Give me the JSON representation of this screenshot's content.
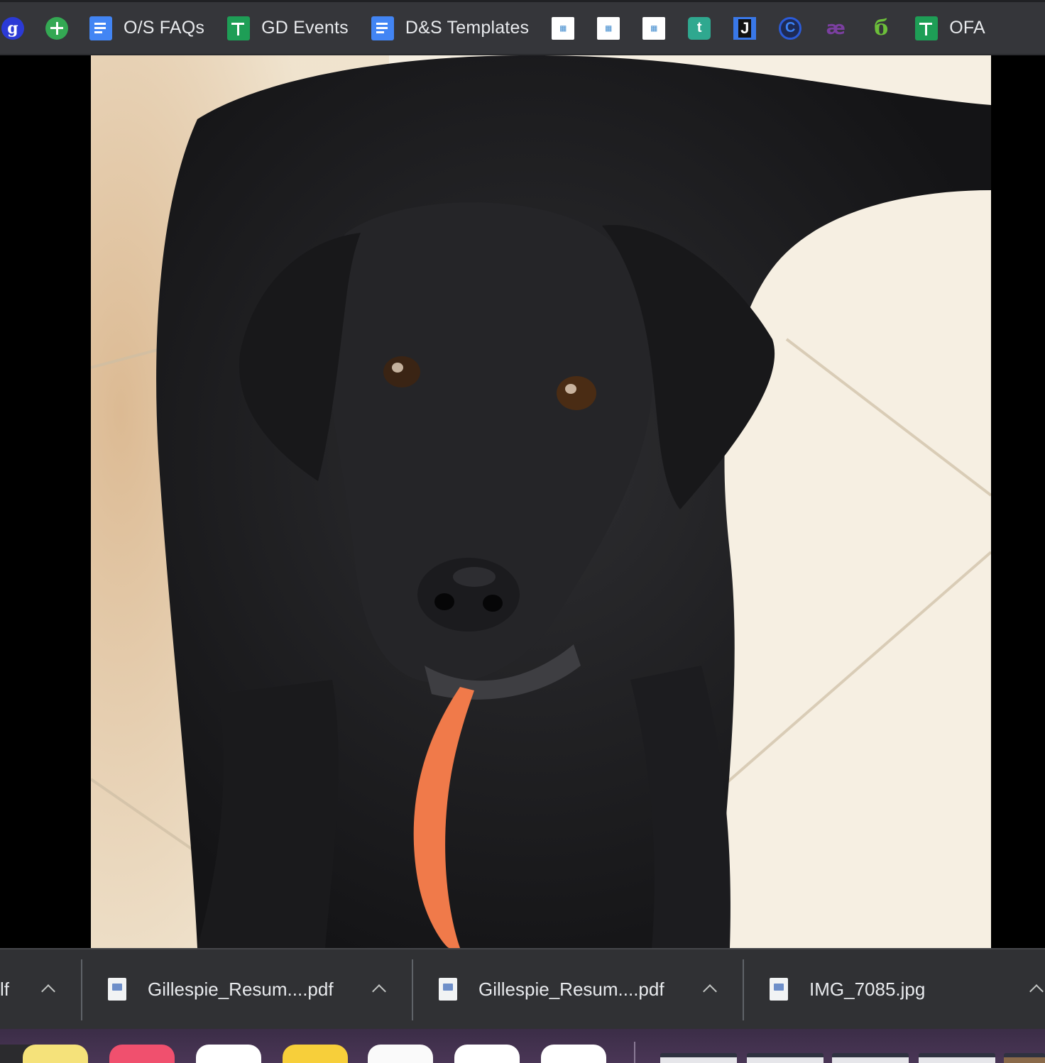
{
  "bookmarks": {
    "items": [
      {
        "icon": "goodreads-g-icon",
        "label": "",
        "glyph": "g"
      },
      {
        "icon": "green-plus-icon",
        "label": ""
      },
      {
        "icon": "google-docs-icon",
        "label": "O/S FAQs"
      },
      {
        "icon": "google-sheets-icon",
        "label": "GD Events"
      },
      {
        "icon": "google-docs-icon",
        "label": "D&S Templates"
      },
      {
        "icon": "grid-app-icon",
        "label": ""
      },
      {
        "icon": "grid-app-icon",
        "label": ""
      },
      {
        "icon": "grid-app-icon",
        "label": ""
      },
      {
        "icon": "t-app-icon",
        "label": "",
        "glyph": "t"
      },
      {
        "icon": "j-app-icon",
        "label": "",
        "glyph": "J"
      },
      {
        "icon": "c-app-icon",
        "label": "",
        "glyph": "C"
      },
      {
        "icon": "ae-app-icon",
        "label": "",
        "glyph": "æ"
      },
      {
        "icon": "leaf-app-icon",
        "label": "",
        "glyph": "б"
      },
      {
        "icon": "google-sheets-icon",
        "label": "OFA"
      }
    ]
  },
  "viewer": {
    "image_subject": "black-dog-photo"
  },
  "downloads": {
    "items": [
      {
        "name": "lf"
      },
      {
        "name": "Gillespie_Resum....pdf"
      },
      {
        "name": "Gillespie_Resum....pdf"
      },
      {
        "name": "IMG_7085.jpg"
      }
    ]
  },
  "colors": {
    "bookmarks_bg": "#35363a",
    "downloads_bg": "#303134",
    "dock_bg": "#3b2d47"
  }
}
